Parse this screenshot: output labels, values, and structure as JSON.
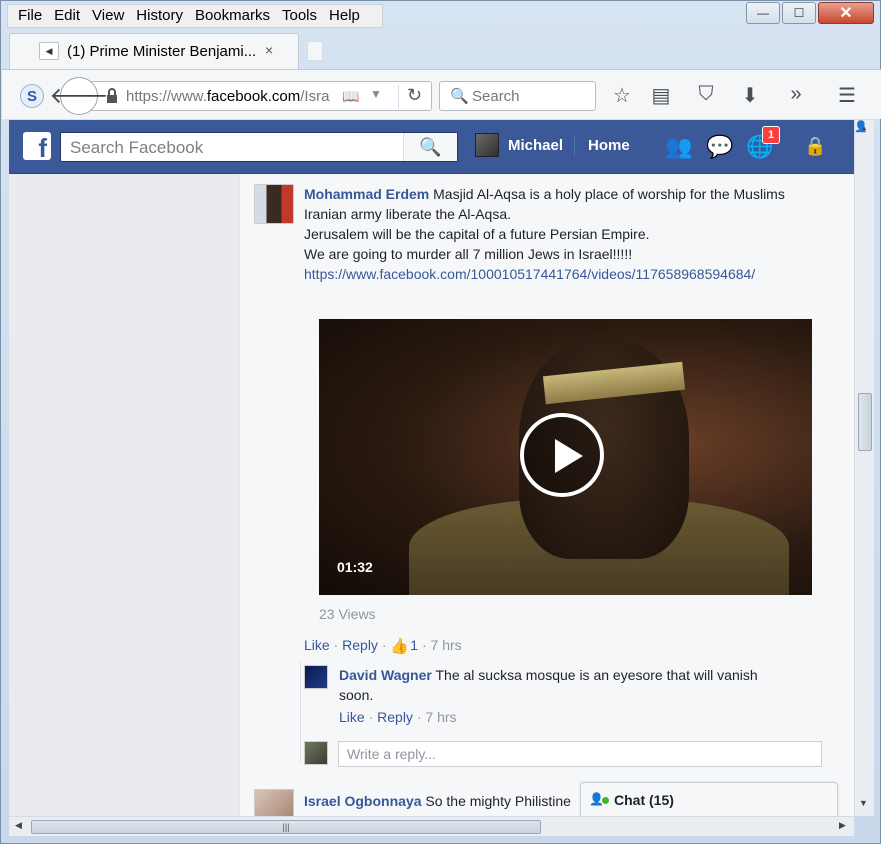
{
  "menubar": {
    "items": [
      {
        "label": "File",
        "key": "F"
      },
      {
        "label": "Edit",
        "key": "E"
      },
      {
        "label": "View",
        "key": "V"
      },
      {
        "label": "History",
        "key": "s"
      },
      {
        "label": "Bookmarks",
        "key": "B"
      },
      {
        "label": "Tools",
        "key": "T"
      },
      {
        "label": "Help",
        "key": "H"
      }
    ]
  },
  "window_controls": {
    "minimize": "—",
    "maximize": "☐",
    "close": "✕"
  },
  "tab": {
    "title": "(1) Prime Minister Benjami...",
    "close": "×",
    "back": "◀"
  },
  "navbar": {
    "url_prefix": "https://www.",
    "url_domain": "facebook.com",
    "url_suffix": "/Isra",
    "search_placeholder": "Search"
  },
  "icons": {
    "toolbar": [
      "star-icon",
      "reading-list-icon",
      "pocket-icon",
      "download-icon",
      "overflow-icon",
      "menu-icon"
    ],
    "facebook": [
      "friends-icon",
      "messages-icon",
      "notifications-icon",
      "privacy-icon"
    ]
  },
  "facebook": {
    "search_placeholder": "Search Facebook",
    "username": "Michael",
    "home": "Home",
    "notification_count": "1",
    "brand_color": "#3b5998"
  },
  "comments": [
    {
      "author": "Mohammad Erdem",
      "lines": [
        "Masjid Al-Aqsa is a holy place of worship for the Muslims",
        "Iranian army liberate the Al-Aqsa.",
        "Jerusalem will be the capital of a future Persian Empire.",
        "We are going to murder all 7 million Jews in Israel!!!!!"
      ],
      "link": "https://www.facebook.com/100010517441764/videos/117658968594684/",
      "video": {
        "duration": "01:32",
        "views": "23 Views"
      },
      "actions": {
        "like": "Like",
        "reply": "Reply",
        "like_count": "1",
        "time": "7 hrs",
        "separator": "·"
      }
    }
  ],
  "reply": {
    "author": "David Wagner",
    "text_line1": "The al sucksa mosque is an eyesore that will vanish",
    "text_line2": "soon.",
    "actions": {
      "like": "Like",
      "reply": "Reply",
      "time": "7 hrs",
      "separator": "·"
    }
  },
  "write_reply_placeholder": "Write a reply...",
  "comment2": {
    "author": "Israel Ogbonnaya",
    "text": "So the mighty Philistine"
  },
  "chat": {
    "label": "Chat (15)"
  }
}
